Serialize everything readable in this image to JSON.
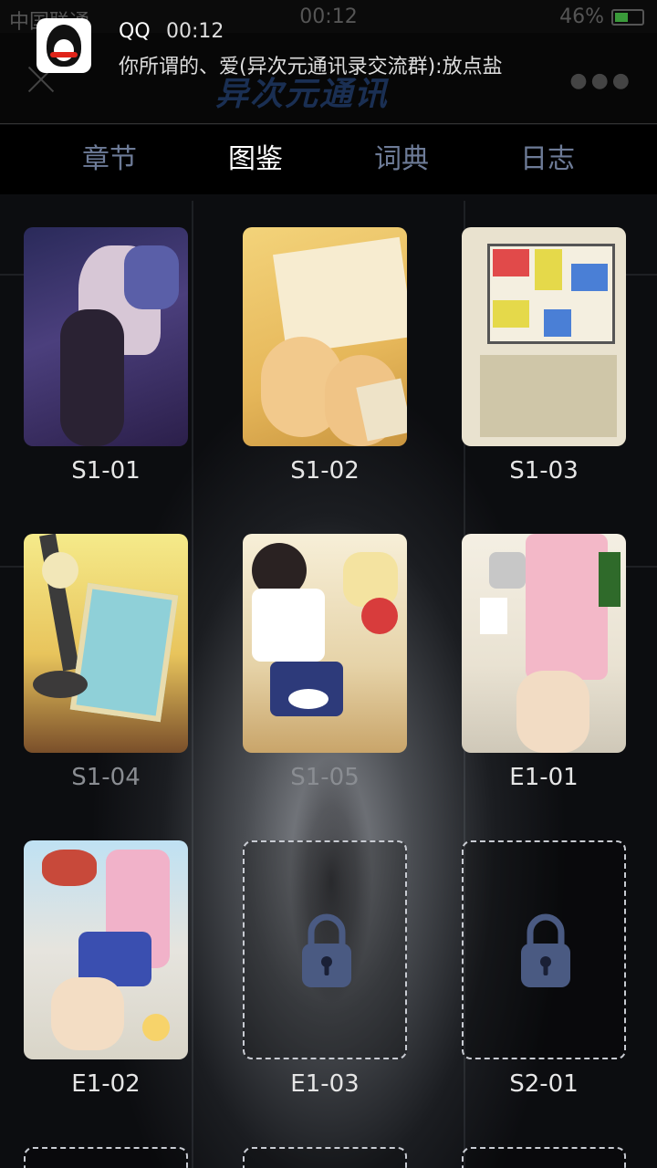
{
  "status_bar": {
    "carrier": "中国联通",
    "time": "00:12",
    "battery": "46%"
  },
  "notification": {
    "app": "QQ",
    "time": "00:12",
    "message": "你所谓的、爱(异次元通讯录交流群):放点盐"
  },
  "header": {
    "logo": "异次元通讯"
  },
  "tabs": [
    {
      "label": "章节",
      "active": false
    },
    {
      "label": "图鉴",
      "active": true
    },
    {
      "label": "词典",
      "active": false
    },
    {
      "label": "日志",
      "active": false
    }
  ],
  "gallery": [
    {
      "label": "S1-01",
      "locked": false
    },
    {
      "label": "S1-02",
      "locked": false
    },
    {
      "label": "S1-03",
      "locked": false
    },
    {
      "label": "S1-04",
      "locked": false
    },
    {
      "label": "S1-05",
      "locked": false
    },
    {
      "label": "E1-01",
      "locked": false
    },
    {
      "label": "E1-02",
      "locked": false
    },
    {
      "label": "E1-03",
      "locked": true
    },
    {
      "label": "S2-01",
      "locked": true
    }
  ],
  "colors": {
    "tab_inactive": "#6d7b97",
    "tab_active": "#ffffff",
    "lock": "#4a5a82"
  }
}
